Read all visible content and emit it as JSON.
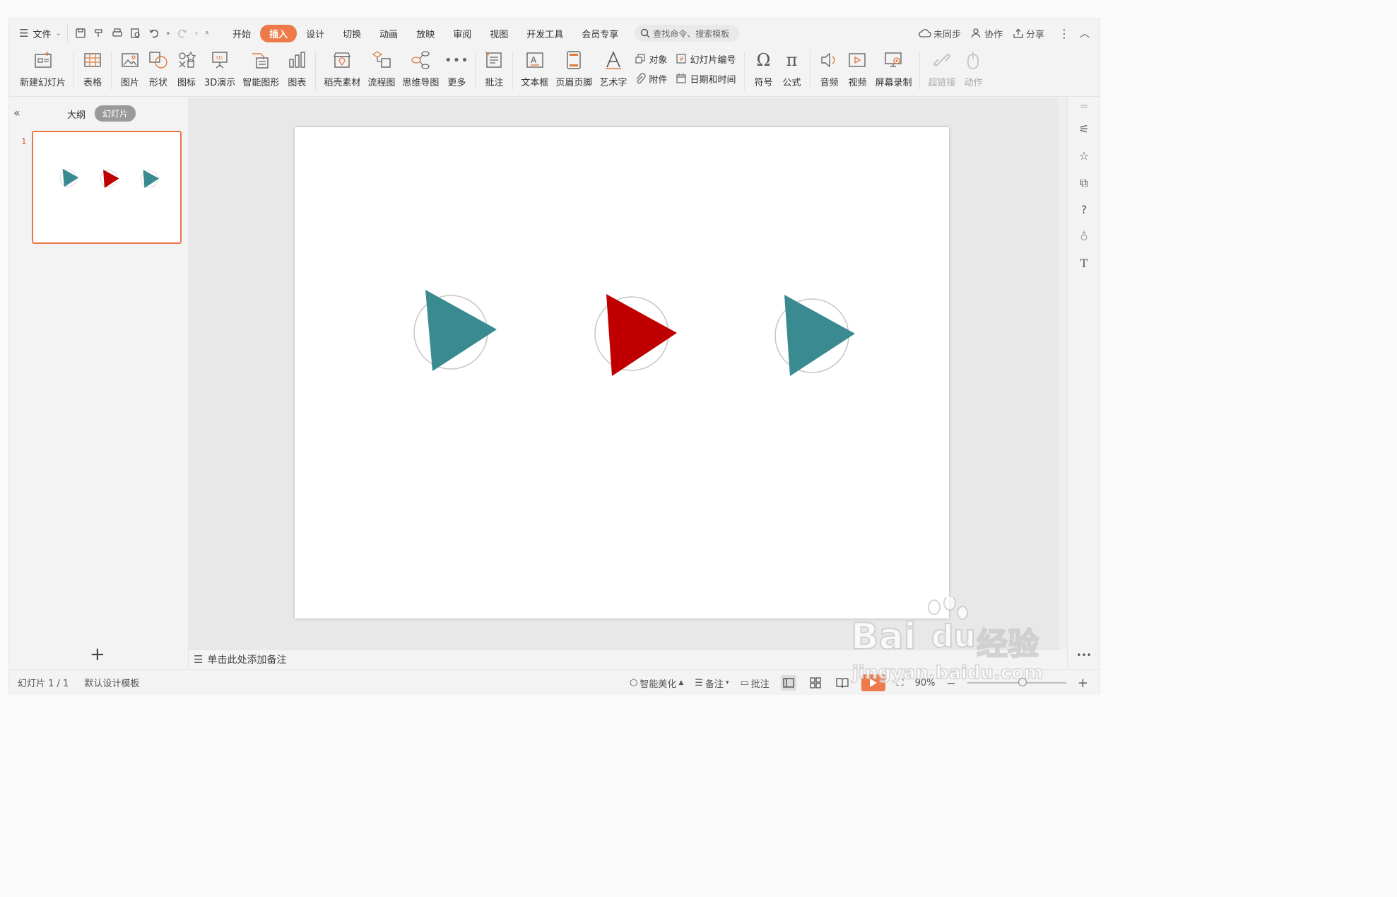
{
  "menu": {
    "file_label": "文件",
    "tabs": [
      "开始",
      "插入",
      "设计",
      "切换",
      "动画",
      "放映",
      "审阅",
      "视图",
      "开发工具",
      "会员专享"
    ],
    "active_tab": "插入",
    "search_placeholder": "查找命令、搜索模板",
    "sync_label": "未同步",
    "collab_label": "协作",
    "share_label": "分享"
  },
  "ribbon": {
    "new_slide": "新建幻灯片",
    "table": "表格",
    "picture": "图片",
    "shape": "形状",
    "icon": "图标",
    "demo3d": "3D演示",
    "smartart": "智能图形",
    "chart": "图表",
    "material": "稻壳素材",
    "flowchart": "流程图",
    "mindmap": "思维导图",
    "more": "更多",
    "comment": "批注",
    "textbox": "文本框",
    "header_footer": "页眉页脚",
    "wordart": "艺术字",
    "object": "对象",
    "attachment": "附件",
    "slide_number": "幻灯片编号",
    "datetime": "日期和时间",
    "symbol": "符号",
    "formula": "公式",
    "audio": "音频",
    "video": "视频",
    "screen_record": "屏幕录制",
    "hyperlink": "超链接",
    "action": "动作"
  },
  "left_panel": {
    "outline_tab": "大纲",
    "slides_tab": "幻灯片",
    "slide_number": "1"
  },
  "notes": {
    "placeholder": "单击此处添加备注"
  },
  "status": {
    "slide_info": "幻灯片 1 / 1",
    "template": "默认设计模板",
    "beautify": "智能美化",
    "notes": "备注",
    "comments": "批注",
    "zoom": "90%"
  },
  "colors": {
    "accent": "#ee7a4a",
    "teal": "#3a8a91",
    "red": "#c00000",
    "circle": "#c8c8c8"
  },
  "watermark": {
    "brand": "Bai",
    "brand2": "du",
    "cn": "经验",
    "url": "jingyan.baidu.com"
  }
}
